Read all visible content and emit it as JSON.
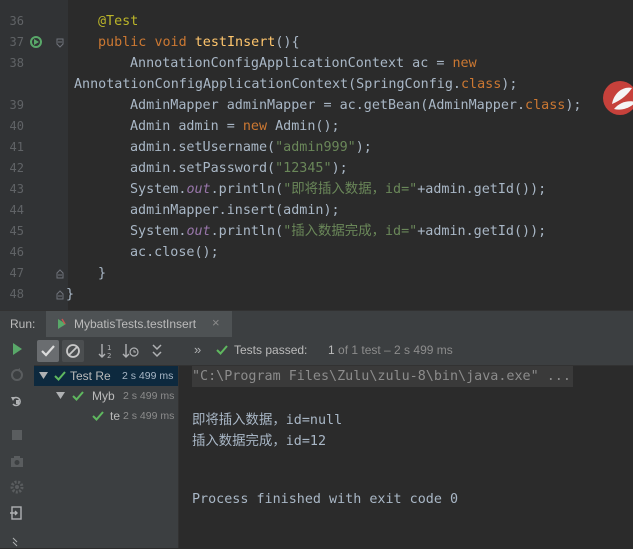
{
  "editor": {
    "lines": [
      {
        "num": "36",
        "tokens": [
          {
            "t": "@Test",
            "c": "ann"
          }
        ]
      },
      {
        "num": "37",
        "tokens": [
          {
            "t": "public",
            "c": "kw"
          },
          {
            "t": " ",
            "c": ""
          },
          {
            "t": "void",
            "c": "kw"
          },
          {
            "t": " ",
            "c": ""
          },
          {
            "t": "testInsert",
            "c": "fn"
          },
          {
            "t": "(){",
            "c": ""
          }
        ]
      },
      {
        "num": "38",
        "tokens": [
          {
            "t": "AnnotationConfigApplicationContext ac = ",
            "c": ""
          },
          {
            "t": "new",
            "c": "kw"
          }
        ]
      },
      {
        "num": "",
        "tokens": [
          {
            "t": "AnnotationConfigApplicationContext(SpringConfig.",
            "c": ""
          },
          {
            "t": "class",
            "c": "kw"
          },
          {
            "t": ");",
            "c": ""
          }
        ]
      },
      {
        "num": "39",
        "tokens": [
          {
            "t": "AdminMapper adminMapper = ac.getBean(AdminMapper.",
            "c": ""
          },
          {
            "t": "class",
            "c": "kw"
          },
          {
            "t": ");",
            "c": ""
          }
        ]
      },
      {
        "num": "40",
        "tokens": [
          {
            "t": "Admin admin = ",
            "c": ""
          },
          {
            "t": "new",
            "c": "kw"
          },
          {
            "t": " Admin();",
            "c": ""
          }
        ]
      },
      {
        "num": "41",
        "tokens": [
          {
            "t": "admin.setUsername(",
            "c": ""
          },
          {
            "t": "\"admin999\"",
            "c": "str"
          },
          {
            "t": ");",
            "c": ""
          }
        ]
      },
      {
        "num": "42",
        "tokens": [
          {
            "t": "admin.setPassword(",
            "c": ""
          },
          {
            "t": "\"12345\"",
            "c": "str"
          },
          {
            "t": ");",
            "c": ""
          }
        ]
      },
      {
        "num": "43",
        "tokens": [
          {
            "t": "System.",
            "c": ""
          },
          {
            "t": "out",
            "c": "fld"
          },
          {
            "t": ".println(",
            "c": ""
          },
          {
            "t": "\"即将插入数据，id=\"",
            "c": "str"
          },
          {
            "t": "+admin.getId());",
            "c": ""
          }
        ]
      },
      {
        "num": "44",
        "tokens": [
          {
            "t": "adminMapper.insert(admin);",
            "c": ""
          }
        ]
      },
      {
        "num": "45",
        "tokens": [
          {
            "t": "System.",
            "c": ""
          },
          {
            "t": "out",
            "c": "fld"
          },
          {
            "t": ".println(",
            "c": ""
          },
          {
            "t": "\"插入数据完成，id=\"",
            "c": "str"
          },
          {
            "t": "+admin.getId());",
            "c": ""
          }
        ]
      },
      {
        "num": "46",
        "tokens": [
          {
            "t": "ac.close();",
            "c": ""
          }
        ]
      },
      {
        "num": "47",
        "tokens": [
          {
            "t": "}",
            "c": ""
          }
        ]
      },
      {
        "num": "48",
        "tokens": [
          {
            "t": "}",
            "c": ""
          }
        ]
      }
    ]
  },
  "run_panel": {
    "label": "Run:",
    "tab_label": "MybatisTests.testInsert",
    "tab_close": "×",
    "status_label": "Tests passed:",
    "status_detail_pre": " 1 ",
    "status_detail_post": "of 1 test – 2 s 499 ms",
    "more_glyph": "»",
    "tree": [
      {
        "name": "Test Re",
        "time": "2 s 499 ms"
      },
      {
        "name": "Myb",
        "time": "2 s 499 ms"
      },
      {
        "name": "te",
        "time": "2 s 499 ms"
      }
    ],
    "console": {
      "cmd": "\"C:\\Program Files\\Zulu\\zulu-8\\bin\\java.exe\" ...",
      "output1": "即将插入数据，id=null",
      "output2": "插入数据完成，id=12",
      "finish": "Process finished with exit code 0"
    }
  },
  "colors": {
    "pass_green": "#5fb85f",
    "run_green": "#59a869"
  }
}
